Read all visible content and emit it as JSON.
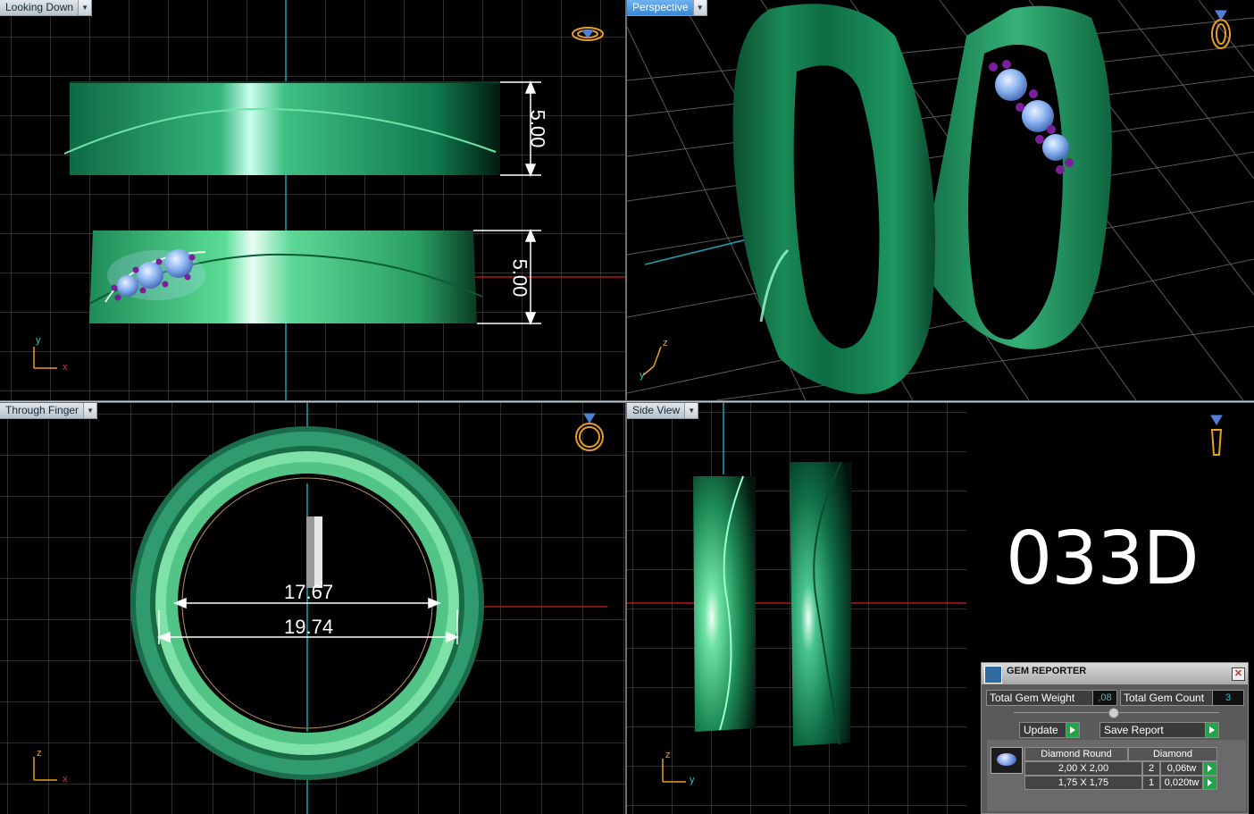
{
  "viewports": {
    "top_left": {
      "label": "Looking Down",
      "dims": [
        "5.00",
        "5.00"
      ]
    },
    "top_right": {
      "label": "Perspective"
    },
    "bottom_left": {
      "label": "Through Finger",
      "dims": [
        "17.67",
        "19.74"
      ]
    },
    "bottom_right": {
      "label": "Side View"
    }
  },
  "axes": {
    "top_left": [
      "y",
      "x"
    ],
    "top_right": [
      "z",
      "y"
    ],
    "bottom_left": [
      "z",
      "x"
    ],
    "bottom_right": [
      "z",
      "y"
    ]
  },
  "design_code": "033D",
  "gem_reporter": {
    "title": "GEM REPORTER",
    "close_label": "✕",
    "total_weight_label": "Total Gem Weight",
    "total_weight_value": ",08",
    "total_count_label": "Total Gem Count",
    "total_count_value": "3",
    "update_label": "Update",
    "save_label": "Save Report",
    "table_header": [
      "Diamond Round",
      "Diamond"
    ],
    "rows": [
      {
        "size": "2,00 X 2,00",
        "count": "2",
        "weight": "0,06tw"
      },
      {
        "size": "1,75 X 1,75",
        "count": "1",
        "weight": "0,020tw"
      }
    ]
  },
  "colors": {
    "ring_green": "#1f8a55",
    "ring_light": "#7ef0b0",
    "grid": "#5a5a5a",
    "axis_cyan": "#1aa3b3",
    "axis_red": "#b01818",
    "gem_blue": "#8cb4f0",
    "prong_purple": "#7a1f9a",
    "accent_orange": "#e8a020"
  }
}
